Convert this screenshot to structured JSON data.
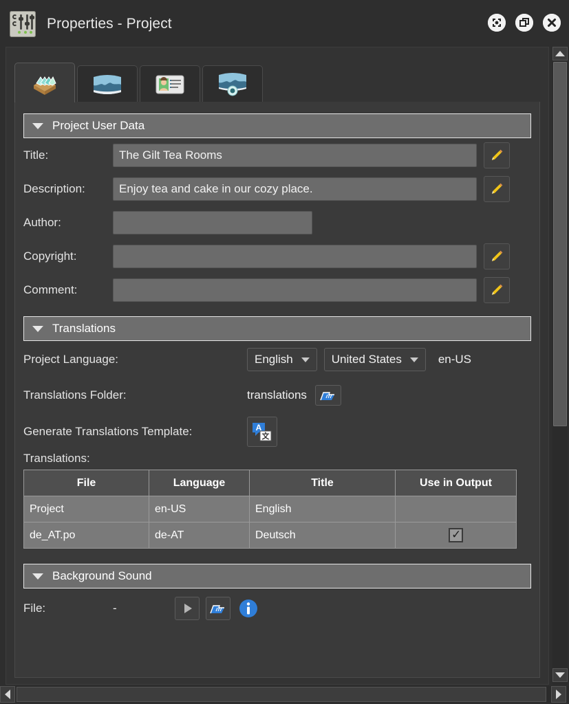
{
  "window": {
    "title": "Properties - Project",
    "app_icon": "mixer-sliders-icon",
    "buttons": [
      {
        "name": "fullscreen-button",
        "icon": "fullscreen-icon"
      },
      {
        "name": "restore-button",
        "icon": "restore-window-icon"
      },
      {
        "name": "close-button",
        "icon": "close-icon"
      }
    ]
  },
  "tabs": [
    {
      "name": "tab-project",
      "icon": "project-stack-icon",
      "active": true
    },
    {
      "name": "tab-panorama",
      "icon": "panorama-icon",
      "active": false
    },
    {
      "name": "tab-user-data",
      "icon": "id-card-icon",
      "active": false
    },
    {
      "name": "tab-panorama-view",
      "icon": "panorama-view-icon",
      "active": false
    }
  ],
  "sections": {
    "user_data": {
      "title": "Project User Data",
      "expanded": true,
      "caret": "caret-down-icon",
      "fields": [
        {
          "label": "Title:",
          "value": "The Gilt Tea Rooms",
          "edit": true,
          "width": "wide"
        },
        {
          "label": "Description:",
          "value": "Enjoy tea and cake in our cozy place.",
          "edit": true,
          "width": "wide"
        },
        {
          "label": "Author:",
          "value": "",
          "edit": false,
          "width": "narrow"
        },
        {
          "label": "Copyright:",
          "value": "",
          "edit": true,
          "width": "wide"
        },
        {
          "label": "Comment:",
          "value": "",
          "edit": true,
          "width": "wide"
        }
      ],
      "edit_icon": "pencil-icon"
    },
    "translations": {
      "title": "Translations",
      "expanded": true,
      "caret": "caret-down-icon",
      "project_language_label": "Project Language:",
      "language": "English",
      "country": "United States",
      "locale_code": "en-US",
      "folder_label": "Translations Folder:",
      "folder_value": "translations",
      "folder_icon": "blue-folder-icon",
      "generate_label": "Generate Translations Template:",
      "generate_icon": "translate-icon",
      "table_label": "Translations:",
      "table": {
        "headers": [
          "File",
          "Language",
          "Title",
          "Use in Output"
        ],
        "rows": [
          {
            "file": "Project",
            "language": "en-US",
            "title": "English",
            "use_in_output": false
          },
          {
            "file": "de_AT.po",
            "language": "de-AT",
            "title": "Deutsch",
            "use_in_output": true
          }
        ]
      }
    },
    "background_sound": {
      "title": "Background Sound",
      "expanded": true,
      "caret": "caret-down-icon",
      "file_label": "File:",
      "file_value": "-",
      "play_icon": "play-icon",
      "folder_icon": "blue-folder-icon",
      "info_icon": "info-icon"
    }
  },
  "scrollbars": {
    "vertical": {
      "up": "arrow-up-icon",
      "down": "arrow-down-icon"
    },
    "horizontal": {
      "left": "arrow-left-icon",
      "right": "arrow-right-icon"
    }
  },
  "colors": {
    "window_bg": "#2e2e2e",
    "panel_bg": "#3a3a3a",
    "section_header_bg": "#6e6e6e",
    "field_bg": "#6b6b6b",
    "accent_blue": "#2f7ed8",
    "pencil_yellow": "#f0c419",
    "table_row_bg": "#7a7a7a"
  }
}
